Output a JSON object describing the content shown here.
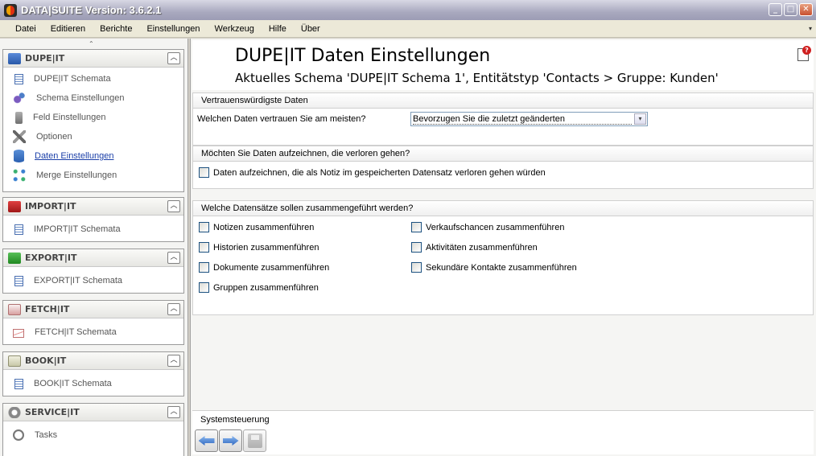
{
  "window": {
    "title": "DATA|SUITE Version: 3.6.2.1"
  },
  "menu": [
    "Datei",
    "Editieren",
    "Berichte",
    "Einstellungen",
    "Werkzeug",
    "Hilfe",
    "Über"
  ],
  "sidebar": {
    "panels": [
      {
        "title": "DUPE|IT",
        "items": [
          {
            "label": "DUPE|IT Schemata",
            "icon": "list-icon"
          },
          {
            "label": "Schema Einstellungen",
            "icon": "gears-icon"
          },
          {
            "label": "Feld Einstellungen",
            "icon": "phone-icon"
          },
          {
            "label": "Optionen",
            "icon": "tools-icon"
          },
          {
            "label": "Daten Einstellungen",
            "icon": "database-icon",
            "active": true
          },
          {
            "label": "Merge Einstellungen",
            "icon": "merge-icon"
          }
        ]
      },
      {
        "title": "IMPORT|IT",
        "items": [
          {
            "label": "IMPORT|IT Schemata",
            "icon": "list-icon"
          }
        ]
      },
      {
        "title": "EXPORT|IT",
        "items": [
          {
            "label": "EXPORT|IT Schemata",
            "icon": "list-icon"
          }
        ]
      },
      {
        "title": "FETCH|IT",
        "items": [
          {
            "label": "FETCH|IT Schemata",
            "icon": "mail-icon"
          }
        ]
      },
      {
        "title": "BOOK|IT",
        "items": [
          {
            "label": "BOOK|IT Schemata",
            "icon": "list-icon"
          }
        ]
      },
      {
        "title": "SERVICE|IT",
        "items": [
          {
            "label": "Tasks",
            "icon": "clock-icon"
          }
        ]
      }
    ]
  },
  "main": {
    "title": "DUPE|IT Daten Einstellungen",
    "subtitle": "Aktuelles Schema 'DUPE|IT Schema 1', Entitätstyp 'Contacts > Gruppe: Kunden'",
    "trust": {
      "section_title": "Vertrauenswürdigste Daten",
      "question": "Welchen Daten vertrauen Sie am meisten?",
      "selected": "Bevorzugen Sie die zuletzt geänderten"
    },
    "lost": {
      "section_title": "Möchten Sie Daten aufzeichnen, die verloren gehen?",
      "checkbox": "Daten aufzeichnen, die als Notiz im gespeicherten Datensatz verloren gehen würden"
    },
    "merge": {
      "section_title": "Welche Datensätze sollen zusammengeführt werden?",
      "left": [
        "Notizen zusammenführen",
        "Historien zusammenführen",
        "Dokumente zusammenführen",
        "Gruppen zusammenführen"
      ],
      "right": [
        "Verkaufschancen zusammenführen",
        "Aktivitäten zusammenführen",
        "Sekundäre Kontakte zusammenführen"
      ]
    },
    "footer": {
      "title": "Systemsteuerung"
    }
  }
}
